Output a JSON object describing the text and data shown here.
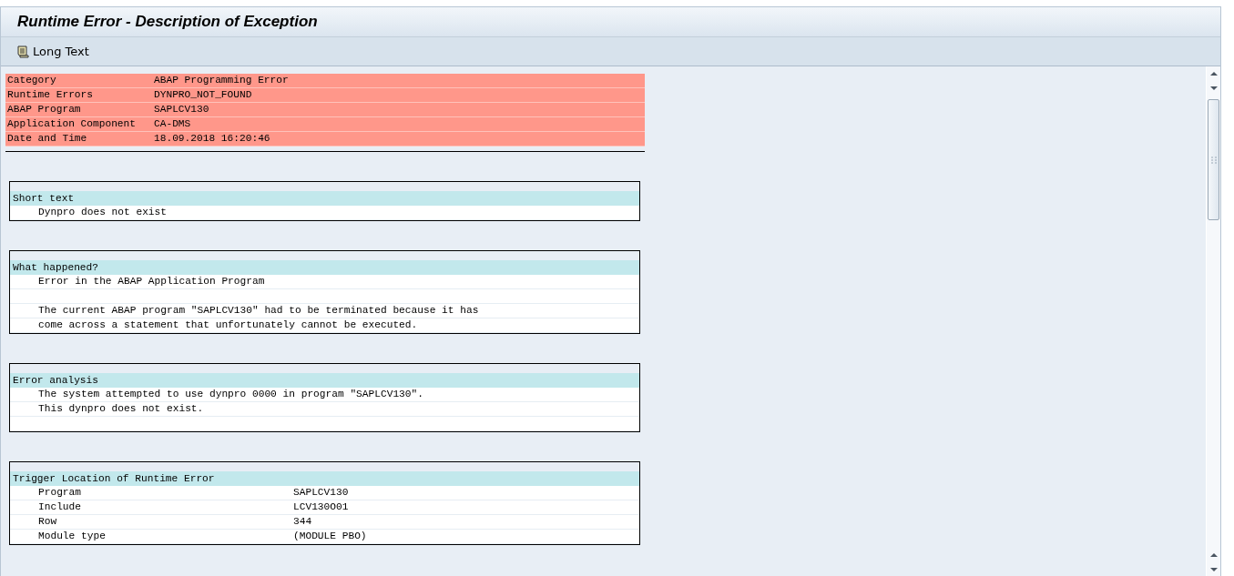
{
  "window": {
    "title": "Runtime Error - Description of Exception"
  },
  "toolbar": {
    "buttons": [
      {
        "label": "Long Text"
      }
    ]
  },
  "summary": [
    {
      "label": "Category",
      "value": "ABAP Programming Error"
    },
    {
      "label": "Runtime Errors",
      "value": "DYNPRO_NOT_FOUND"
    },
    {
      "label": "ABAP Program",
      "value": "SAPLCV130"
    },
    {
      "label": "Application Component",
      "value": "CA-DMS"
    },
    {
      "label": "Date and Time",
      "value": "18.09.2018 16:20:46"
    }
  ],
  "sections": [
    {
      "title": "Short text",
      "rows": [
        {
          "kind": "text",
          "text": "Dynpro does not exist"
        }
      ]
    },
    {
      "title": "What happened?",
      "rows": [
        {
          "kind": "text",
          "text": "Error in the ABAP Application Program"
        },
        {
          "kind": "blank"
        },
        {
          "kind": "text",
          "text": "The current ABAP program \"SAPLCV130\" had to be terminated because it has"
        },
        {
          "kind": "text",
          "text": "come across a statement that unfortunately cannot be executed."
        }
      ]
    },
    {
      "title": "Error analysis",
      "rows": [
        {
          "kind": "text",
          "text": "The system attempted to use dynpro 0000 in program \"SAPLCV130\"."
        },
        {
          "kind": "text",
          "text": "This dynpro does not exist."
        },
        {
          "kind": "blank"
        }
      ]
    },
    {
      "title": "Trigger Location of Runtime Error",
      "rows": [
        {
          "kind": "pair",
          "label": "Program",
          "value": "SAPLCV130"
        },
        {
          "kind": "pair",
          "label": "Include",
          "value": "LCV130O01"
        },
        {
          "kind": "pair",
          "label": "Row",
          "value": "344"
        },
        {
          "kind": "pair",
          "label": "Module type",
          "value": "(MODULE PBO)"
        }
      ]
    }
  ]
}
